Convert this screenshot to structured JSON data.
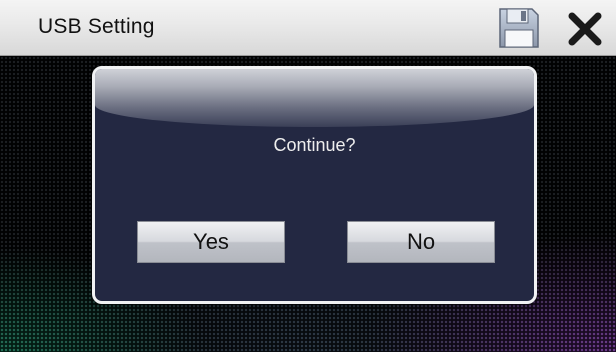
{
  "title_bar": {
    "title": "USB Setting",
    "save_icon": "floppy-disk-save-icon",
    "close_icon": "close-x-icon"
  },
  "dialog": {
    "message": "Continue?",
    "yes_label": "Yes",
    "no_label": "No"
  },
  "colors": {
    "title_bar": "#e6e6e6",
    "dialog_body": "#232842",
    "dialog_border": "#f1f2f4",
    "button_face": "#d7d9de",
    "accent_purple": "#963cc8",
    "accent_green": "#14a06e"
  }
}
